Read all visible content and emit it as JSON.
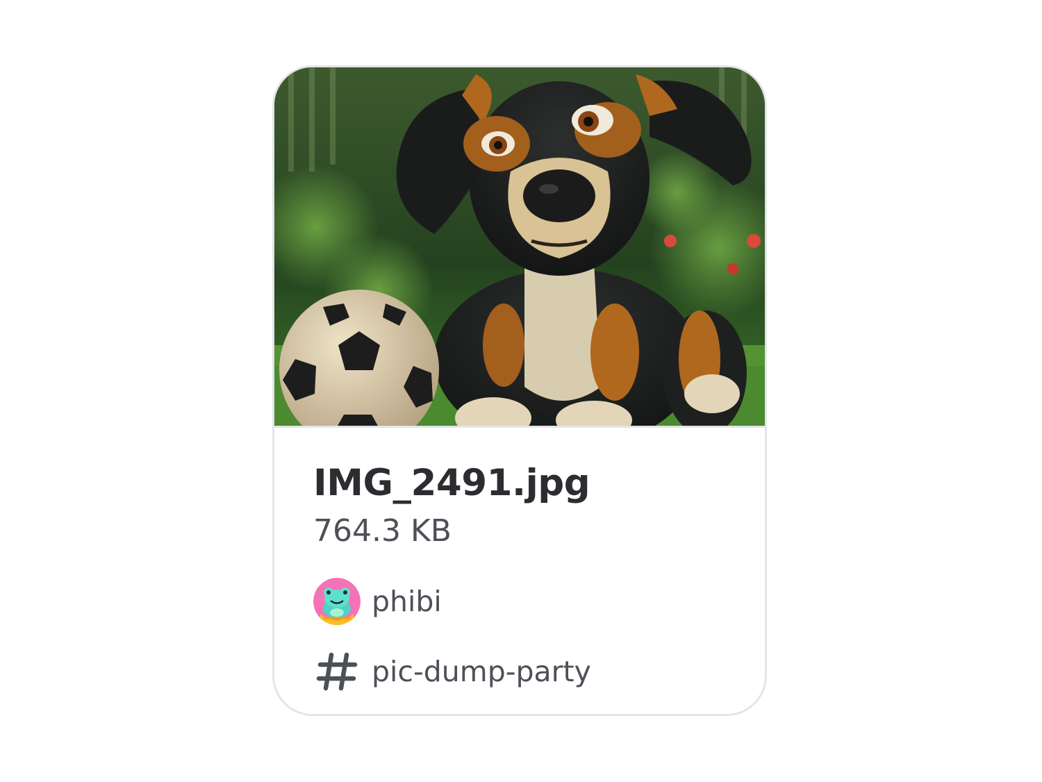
{
  "attachment": {
    "image_alt": "Dog with soccer ball",
    "file_name": "IMG_2491.jpg",
    "file_size": "764.3 KB",
    "uploader": {
      "name": "phibi",
      "avatar_icon": "frog-avatar-icon"
    },
    "channel": {
      "icon": "hash-icon",
      "name": "pic-dump-party"
    }
  },
  "colors": {
    "border": "#e3e5e8",
    "title_text": "#2b2d31",
    "secondary_text": "#4e5058",
    "avatar_bg": "#f472b6",
    "avatar_frog": "#4fd1c5"
  }
}
